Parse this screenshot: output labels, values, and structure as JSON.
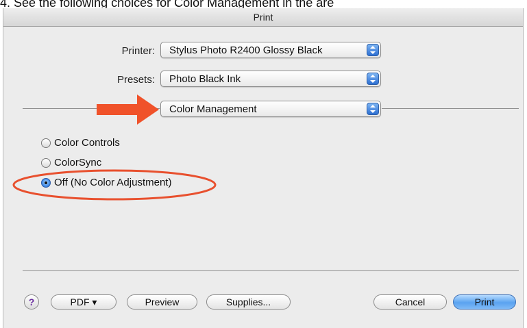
{
  "caption": "4. See the following choices for Color Management in the are",
  "window": {
    "title": "Print"
  },
  "printer": {
    "label": "Printer:",
    "value": "Stylus Photo R2400 Glossy Black"
  },
  "presets": {
    "label": "Presets:",
    "value": "Photo Black Ink"
  },
  "pane": {
    "value": "Color Management"
  },
  "color_options": [
    {
      "label": "Color Controls",
      "selected": false
    },
    {
      "label": "ColorSync",
      "selected": false
    },
    {
      "label": "Off (No Color Adjustment)",
      "selected": true
    }
  ],
  "buttons": {
    "help": "?",
    "pdf": "PDF ▾",
    "preview": "Preview",
    "supplies": "Supplies...",
    "cancel": "Cancel",
    "print": "Print"
  },
  "annotation_colors": {
    "arrow": "#f0522a",
    "ellipse": "#e8502e"
  },
  "accent": "#4c94ea"
}
